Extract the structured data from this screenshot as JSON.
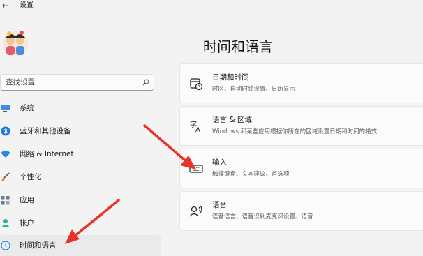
{
  "window": {
    "title": "设置"
  },
  "search": {
    "placeholder": "查找设置"
  },
  "sidebar": {
    "items": [
      {
        "label": "系统"
      },
      {
        "label": "蓝牙和其他设备"
      },
      {
        "label": "网络 & Internet"
      },
      {
        "label": "个性化"
      },
      {
        "label": "应用"
      },
      {
        "label": "帐户"
      },
      {
        "label": "时间和语言"
      }
    ],
    "selected_index": 6
  },
  "main": {
    "title": "时间和语言",
    "cards": [
      {
        "title": "日期和时间",
        "desc": "时区、自动时钟设置、日历显示",
        "icon": "clock-icon"
      },
      {
        "title": "语言 & 区域",
        "desc": "Windows 和某些应用根据你所在的区域设置日期和时间的格式",
        "icon": "language-icon"
      },
      {
        "title": "输入",
        "desc": "触摸键盘、文本建议、首选项",
        "icon": "keyboard-icon"
      },
      {
        "title": "语音",
        "desc": "语音语言、语音识别麦克风设置、语音",
        "icon": "speech-icon"
      }
    ]
  },
  "colors": {
    "accent": "#0067c0",
    "annotation_arrow": "#e8332a"
  }
}
